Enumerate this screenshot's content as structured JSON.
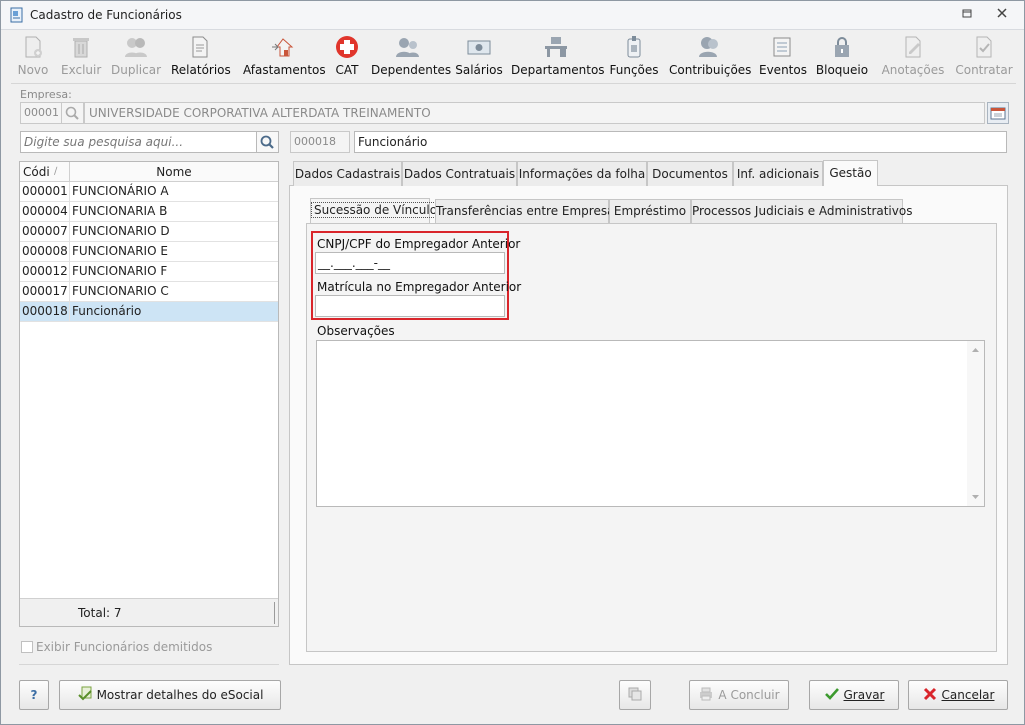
{
  "window": {
    "title": "Cadastro de Funcionários"
  },
  "toolbar": {
    "items": [
      {
        "label": "Novo",
        "icon": "new-doc-icon",
        "enabled": false
      },
      {
        "label": "Excluir",
        "icon": "trash-icon",
        "enabled": false
      },
      {
        "label": "Duplicar",
        "icon": "duplicate-users-icon",
        "enabled": false
      },
      {
        "label": "Relatórios",
        "icon": "report-icon",
        "enabled": true
      },
      {
        "label": "Afastamentos",
        "icon": "home-arrow-icon",
        "enabled": true
      },
      {
        "label": "CAT",
        "icon": "medical-cross-icon",
        "enabled": true
      },
      {
        "label": "Dependentes",
        "icon": "dependents-icon",
        "enabled": true
      },
      {
        "label": "Salários",
        "icon": "money-icon",
        "enabled": true
      },
      {
        "label": "Departamentos",
        "icon": "desk-icon",
        "enabled": true
      },
      {
        "label": "Funções",
        "icon": "badge-icon",
        "enabled": true
      },
      {
        "label": "Contribuições",
        "icon": "people-icon",
        "enabled": true
      },
      {
        "label": "Eventos",
        "icon": "list-icon",
        "enabled": true
      },
      {
        "label": "Bloqueio",
        "icon": "lock-icon",
        "enabled": true
      },
      {
        "label": "Anotações",
        "icon": "notes-icon",
        "enabled": false
      },
      {
        "label": "Contratar",
        "icon": "contract-icon",
        "enabled": false
      }
    ]
  },
  "empresa": {
    "label": "Empresa:",
    "code": "00001",
    "name": "UNIVERSIDADE CORPORATIVA ALTERDATA TREINAMENTO"
  },
  "search": {
    "placeholder": "Digite sua pesquisa aqui..."
  },
  "employee": {
    "code": "000018",
    "name": "Funcionário"
  },
  "grid": {
    "col_code": "Códi",
    "col_name": "Nome",
    "rows": [
      {
        "code": "000001",
        "name": "FUNCIONÁRIO A"
      },
      {
        "code": "000004",
        "name": "FUNCIONARIA B"
      },
      {
        "code": "000007",
        "name": "FUNCIONARIO D"
      },
      {
        "code": "000008",
        "name": "FUNCIONARIO E"
      },
      {
        "code": "000012",
        "name": "FUNCIONARIO F"
      },
      {
        "code": "000017",
        "name": "FUNCIONARIO C"
      },
      {
        "code": "000018",
        "name": "Funcionário"
      }
    ],
    "selected_index": 6,
    "total": "Total: 7"
  },
  "show_dismissed": {
    "label": "Exibir Funcionários demitidos",
    "checked": false
  },
  "main_tabs": [
    {
      "label": "Dados Cadastrais",
      "active": false
    },
    {
      "label": "Dados Contratuais",
      "active": false
    },
    {
      "label": "Informações da folha",
      "active": false
    },
    {
      "label": "Documentos",
      "active": false
    },
    {
      "label": "Inf. adicionais",
      "active": false
    },
    {
      "label": "Gestão",
      "active": true
    }
  ],
  "sub_tabs": [
    {
      "label": "Sucessão de Vínculo",
      "active": true
    },
    {
      "label": "Transferências entre Empresas",
      "active": false
    },
    {
      "label": "Empréstimo",
      "active": false
    },
    {
      "label": "Processos Judiciais e Administrativos",
      "active": false
    }
  ],
  "form": {
    "cnpj_label": "CNPJ/CPF do Empregador Anterior",
    "cnpj_value": "__.___.___-__",
    "matricula_label": "Matrícula no Empregador Anterior",
    "matricula_value": "",
    "obs_label": "Observações",
    "obs_value": ""
  },
  "footer": {
    "help_label": "?",
    "esocial_label": "Mostrar detalhes do eSocial",
    "concluir_label": "A Concluir",
    "gravar_label": "Gravar",
    "cancelar_label": "Cancelar"
  },
  "colors": {
    "highlight": "#d9252b",
    "selected_row": "#cde4f5",
    "cat_red": "#e0352b",
    "check_green": "#3c9a2e"
  }
}
